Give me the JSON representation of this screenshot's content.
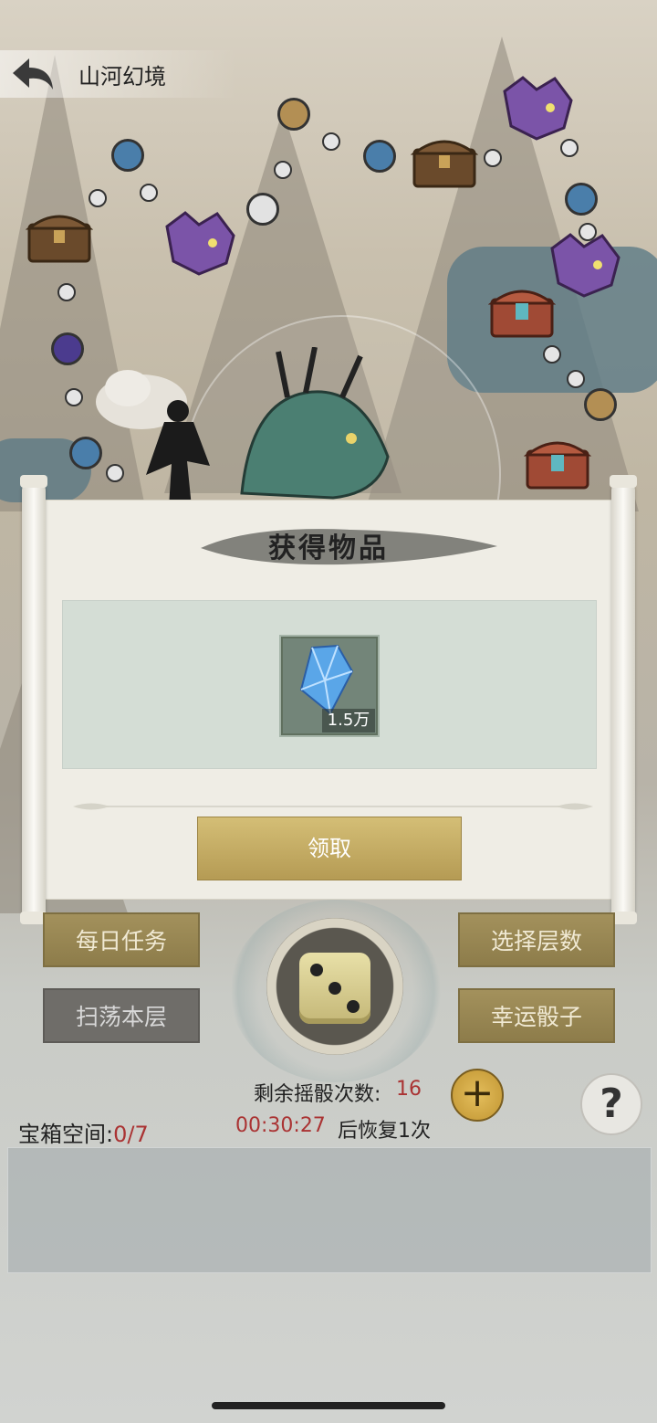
{
  "header": {
    "title": "山河幻境"
  },
  "popup": {
    "title": "获得物品",
    "item": {
      "icon": "blue-crystal-icon",
      "quantity": "1.5万"
    },
    "claim_label": "领取"
  },
  "menu": {
    "daily_tasks": "每日任务",
    "select_floor": "选择层数",
    "sweep_floor": "扫荡本层",
    "lucky_dice": "幸运骰子"
  },
  "dice": {
    "remaining_label": "剩余摇骰次数:",
    "remaining_value": "16",
    "timer": "00:30:27",
    "recover_text": "后恢复1次"
  },
  "chest_space": {
    "label": "宝箱空间:",
    "value": "0/7"
  },
  "colors": {
    "accent_gold": "#b59b54",
    "alert_red": "#aa3333"
  }
}
